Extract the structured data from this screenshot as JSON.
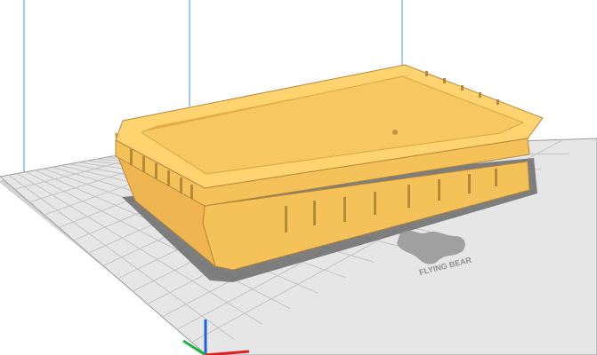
{
  "viewport": {
    "background": "#ffffff",
    "build_plate": {
      "surface_color": "#e6e6e6",
      "grid_color": "#c4c4c4",
      "edge_color": "#9a9a9a",
      "underside_color": "#d2d2d2",
      "logo": {
        "text": "FLYING BEAR",
        "color": "#8e8e8e"
      }
    },
    "model": {
      "type": "rectangular-tray",
      "body_color": "#f5c25a",
      "rim_color": "#ffd470",
      "inner_color": "#f7c862",
      "dark_color": "#b5883a",
      "shadow_color": "#6b6b6b"
    },
    "axes": {
      "x_color": "#e02020",
      "y_color": "#20b040",
      "z_color": "#2060e0"
    },
    "guide_line_color": "#4a8df0"
  }
}
